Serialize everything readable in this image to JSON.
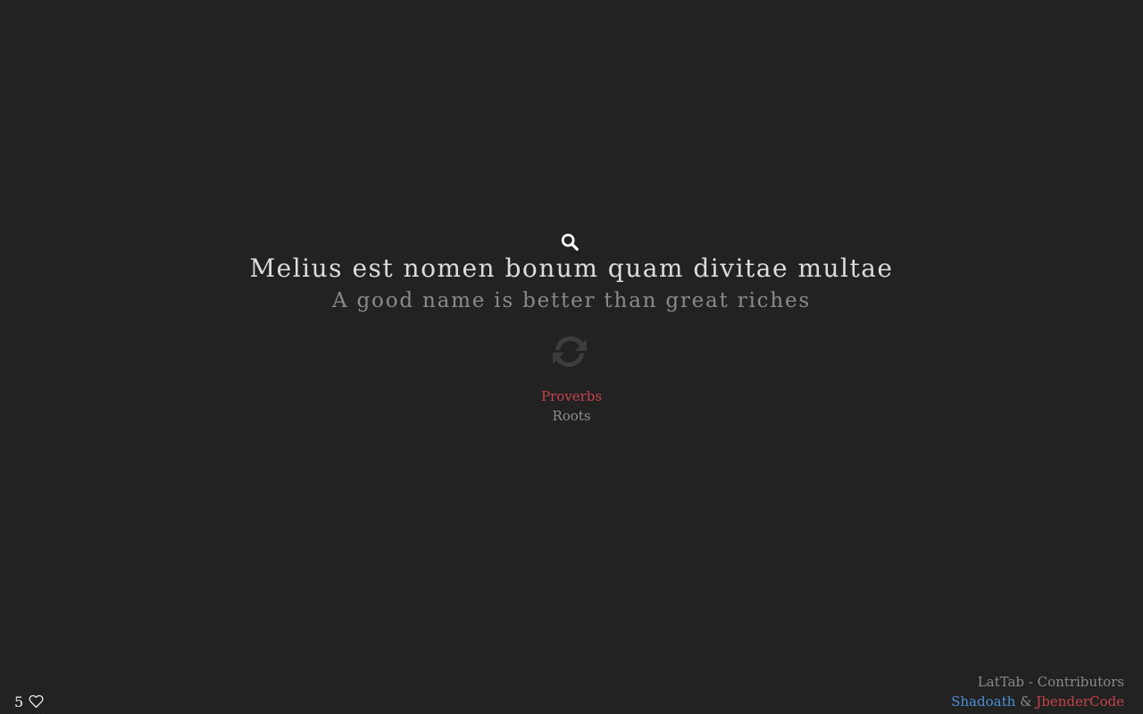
{
  "search": {
    "icon": "search-icon"
  },
  "quote": {
    "latin": "Melius est nomen bonum quam divitae multae",
    "english": "A good name is better than great riches",
    "refresh_icon": "refresh-icon",
    "category": "Proverbs",
    "subcategory": "Roots"
  },
  "favorites": {
    "count": "5",
    "icon": "heart-outline-icon"
  },
  "credits": {
    "title": "LatTab - Contributors",
    "contributor_1": "Shadoath",
    "separator": "&",
    "contributor_2": "JbenderCode"
  },
  "colors": {
    "background": "#222222",
    "accent_red": "#c8434b",
    "accent_blue": "#4d8fd6"
  }
}
